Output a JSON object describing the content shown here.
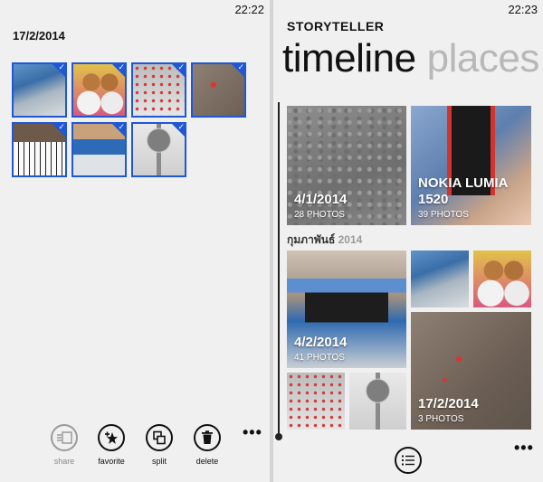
{
  "left_phone": {
    "clock": "22:22",
    "date_title": "17/2/2014",
    "thumbnails": [
      {
        "name": "lumia-box",
        "selected": true
      },
      {
        "name": "plush-toys",
        "selected": true
      },
      {
        "name": "tablecloth",
        "selected": true
      },
      {
        "name": "laser-dot",
        "selected": true
      },
      {
        "name": "piano-keys",
        "selected": true
      },
      {
        "name": "desk-items",
        "selected": true
      },
      {
        "name": "desk-fan",
        "selected": true
      }
    ],
    "appbar": {
      "share": "share",
      "favorite": "favorite",
      "split": "split",
      "delete": "delete",
      "more": "•••"
    }
  },
  "right_phone": {
    "clock": "22:23",
    "app_title": "STORYTELLER",
    "pivot": {
      "active": "timeline",
      "inactive": "places"
    },
    "tiles": {
      "t1": {
        "title": "4/1/2014",
        "count": "28 PHOTOS"
      },
      "t2": {
        "title": "NOKIA LUMIA 1520",
        "count": "39 PHOTOS"
      },
      "t3": {
        "title": "4/2/2014",
        "count": "41 PHOTOS"
      },
      "t4": {
        "title": "17/2/2014",
        "count": "3 PHOTOS"
      }
    },
    "month": {
      "name": "กุมภาพันธ์",
      "year": "2014"
    },
    "more": "•••"
  },
  "colors": {
    "accent": "#1f57d6",
    "background": "#f0f0f0"
  }
}
